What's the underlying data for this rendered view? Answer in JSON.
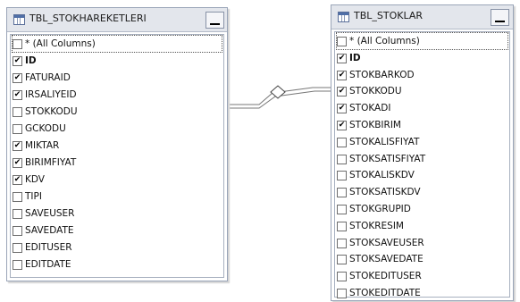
{
  "left_table": {
    "title": "TBL_STOKHAREKETLERI",
    "columns": [
      {
        "label": "* (All Columns)",
        "checked": false,
        "key": false
      },
      {
        "label": "ID",
        "checked": true,
        "key": true
      },
      {
        "label": "FATURAID",
        "checked": true,
        "key": false
      },
      {
        "label": "IRSALIYEID",
        "checked": true,
        "key": false
      },
      {
        "label": "STOKKODU",
        "checked": false,
        "key": false
      },
      {
        "label": "GCKODU",
        "checked": false,
        "key": false
      },
      {
        "label": "MIKTAR",
        "checked": true,
        "key": false
      },
      {
        "label": "BIRIMFIYAT",
        "checked": true,
        "key": false
      },
      {
        "label": "KDV",
        "checked": true,
        "key": false
      },
      {
        "label": "TIPI",
        "checked": false,
        "key": false
      },
      {
        "label": "SAVEUSER",
        "checked": false,
        "key": false
      },
      {
        "label": "SAVEDATE",
        "checked": false,
        "key": false
      },
      {
        "label": "EDITUSER",
        "checked": false,
        "key": false
      },
      {
        "label": "EDITDATE",
        "checked": false,
        "key": false
      }
    ]
  },
  "right_table": {
    "title": "TBL_STOKLAR",
    "columns": [
      {
        "label": "* (All Columns)",
        "checked": false,
        "key": false
      },
      {
        "label": "ID",
        "checked": true,
        "key": true
      },
      {
        "label": "STOKBARKOD",
        "checked": true,
        "key": false
      },
      {
        "label": "STOKKODU",
        "checked": true,
        "key": false
      },
      {
        "label": "STOKADI",
        "checked": true,
        "key": false
      },
      {
        "label": "STOKBIRIM",
        "checked": true,
        "key": false
      },
      {
        "label": "STOKALISFIYAT",
        "checked": false,
        "key": false
      },
      {
        "label": "STOKSATISFIYAT",
        "checked": false,
        "key": false
      },
      {
        "label": "STOKALISKDV",
        "checked": false,
        "key": false
      },
      {
        "label": "STOKSATISKDV",
        "checked": false,
        "key": false
      },
      {
        "label": "STOKGRUPID",
        "checked": false,
        "key": false
      },
      {
        "label": "STOKRESIM",
        "checked": false,
        "key": false
      },
      {
        "label": "STOKSAVEUSER",
        "checked": false,
        "key": false
      },
      {
        "label": "STOKSAVEDATE",
        "checked": false,
        "key": false
      },
      {
        "label": "STOKEDITUSER",
        "checked": false,
        "key": false
      },
      {
        "label": "STOKEDITDATE",
        "checked": false,
        "key": false
      }
    ]
  },
  "icons": {
    "table": "table-icon",
    "minimize": "minimize-icon",
    "checkbox": "checkbox-icon",
    "join": "join-icon"
  },
  "colors": {
    "title_bar": "#e3e6ec",
    "border": "#9aa5b8",
    "join_line": "#555555"
  }
}
